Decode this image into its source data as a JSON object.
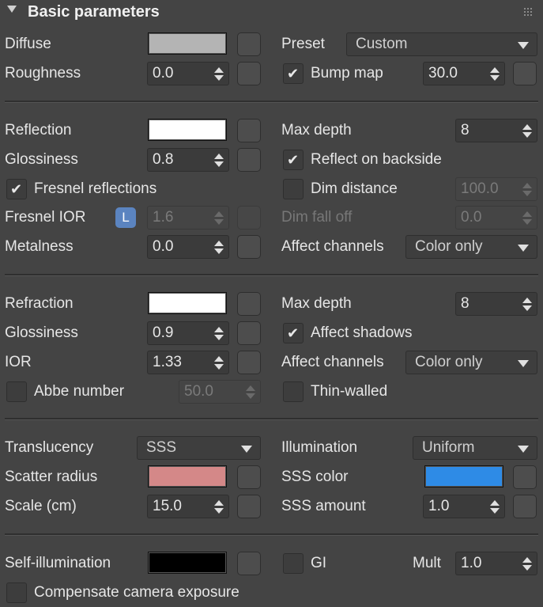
{
  "header": {
    "title": "Basic parameters",
    "collapse_icon": "triangle-down-icon",
    "grip_icon": "grip-dots-icon"
  },
  "diffuse": {
    "diffuse_label": "Diffuse",
    "diffuse_color": "#b4b4b4",
    "preset_label": "Preset",
    "preset_value": "Custom",
    "roughness_label": "Roughness",
    "roughness_value": "0.0",
    "bump_label": "Bump map",
    "bump_checked": true,
    "bump_value": "30.0"
  },
  "reflection": {
    "reflection_label": "Reflection",
    "reflection_color": "#ffffff",
    "max_depth_label": "Max depth",
    "max_depth_value": "8",
    "glossiness_label": "Glossiness",
    "glossiness_value": "0.8",
    "backside_label": "Reflect on backside",
    "backside_checked": true,
    "fresnel_label": "Fresnel reflections",
    "fresnel_checked": true,
    "dim_distance_label": "Dim distance",
    "dim_distance_checked": false,
    "dim_distance_value": "100.0",
    "fresnel_ior_label": "Fresnel IOR",
    "fresnel_ior_lock": "L",
    "fresnel_ior_value": "1.6",
    "dim_falloff_label": "Dim fall off",
    "dim_falloff_value": "0.0",
    "metalness_label": "Metalness",
    "metalness_value": "0.0",
    "affect_channels_label": "Affect channels",
    "affect_channels_value": "Color only"
  },
  "refraction": {
    "refraction_label": "Refraction",
    "refraction_color": "#ffffff",
    "max_depth_label": "Max depth",
    "max_depth_value": "8",
    "glossiness_label": "Glossiness",
    "glossiness_value": "0.9",
    "affect_shadows_label": "Affect shadows",
    "affect_shadows_checked": true,
    "ior_label": "IOR",
    "ior_value": "1.33",
    "affect_channels_label": "Affect channels",
    "affect_channels_value": "Color only",
    "abbe_label": "Abbe number",
    "abbe_checked": false,
    "abbe_value": "50.0",
    "thin_walled_label": "Thin-walled",
    "thin_walled_checked": false
  },
  "translucency": {
    "translucency_label": "Translucency",
    "translucency_value": "SSS",
    "illumination_label": "Illumination",
    "illumination_value": "Uniform",
    "scatter_radius_label": "Scatter radius",
    "scatter_radius_color": "#d48888",
    "sss_color_label": "SSS color",
    "sss_color": "#2e8be6",
    "scale_label": "Scale (cm)",
    "scale_value": "15.0",
    "sss_amount_label": "SSS amount",
    "sss_amount_value": "1.0"
  },
  "self_illum": {
    "self_illum_label": "Self-illumination",
    "self_illum_color": "#000000",
    "gi_label": "GI",
    "gi_checked": false,
    "mult_label": "Mult",
    "mult_value": "1.0",
    "compensate_label": "Compensate camera exposure",
    "compensate_checked": false
  }
}
